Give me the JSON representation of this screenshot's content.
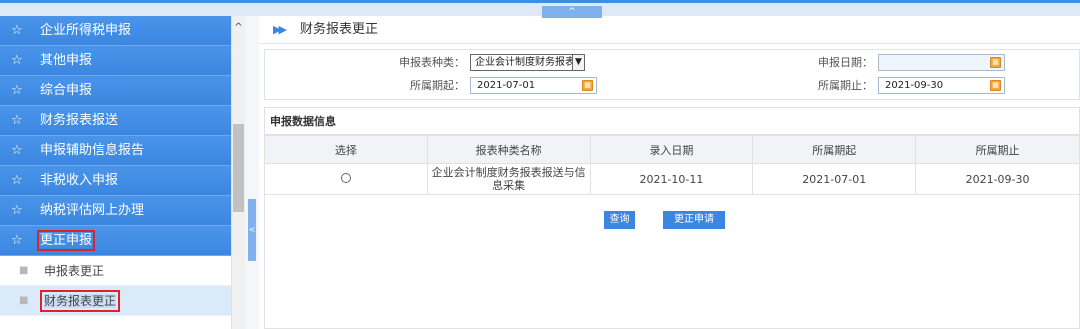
{
  "topbar": {
    "collapse_glyph": "^"
  },
  "sidebar": {
    "items": [
      {
        "label": "企业所得税申报",
        "icon": "star-icon"
      },
      {
        "label": "其他申报",
        "icon": "star-icon"
      },
      {
        "label": "综合申报",
        "icon": "star-icon"
      },
      {
        "label": "财务报表报送",
        "icon": "star-icon"
      },
      {
        "label": "申报辅助信息报告",
        "icon": "star-icon"
      },
      {
        "label": "非税收入申报",
        "icon": "star-icon"
      },
      {
        "label": "纳税评估网上办理",
        "icon": "star-icon"
      },
      {
        "label": "更正申报",
        "icon": "star-icon",
        "active": true
      }
    ],
    "subitems": [
      {
        "label": "申报表更正"
      },
      {
        "label": "财务报表更正",
        "current": true
      }
    ]
  },
  "scrollbar": {
    "up_glyph": "^"
  },
  "divider": {
    "collapse_glyph": "<"
  },
  "page": {
    "title": "财务报表更正"
  },
  "form": {
    "report_type_label": "申报表种类：",
    "report_type_value": "企业会计制度财务报表",
    "declare_date_label": "申报日期：",
    "declare_date_value": "",
    "period_start_label": "所属期起：",
    "period_start_value": "2021-07-01",
    "period_end_label": "所属期止：",
    "period_end_value": "2021-09-30"
  },
  "section": {
    "title": "申报数据信息",
    "columns": [
      "选择",
      "报表种类名称",
      "录入日期",
      "所属期起",
      "所属期止"
    ],
    "rows": [
      {
        "name": "企业会计制度财务报表报送与信息采集",
        "entry_date": "2021-10-11",
        "start": "2021-07-01",
        "end": "2021-09-30"
      }
    ]
  },
  "buttons": {
    "query": "查询",
    "correct": "更正申请"
  },
  "colors": {
    "accent": "#3b86e0",
    "highlight_border": "#d9252a",
    "calendar": "#f2a73a"
  }
}
